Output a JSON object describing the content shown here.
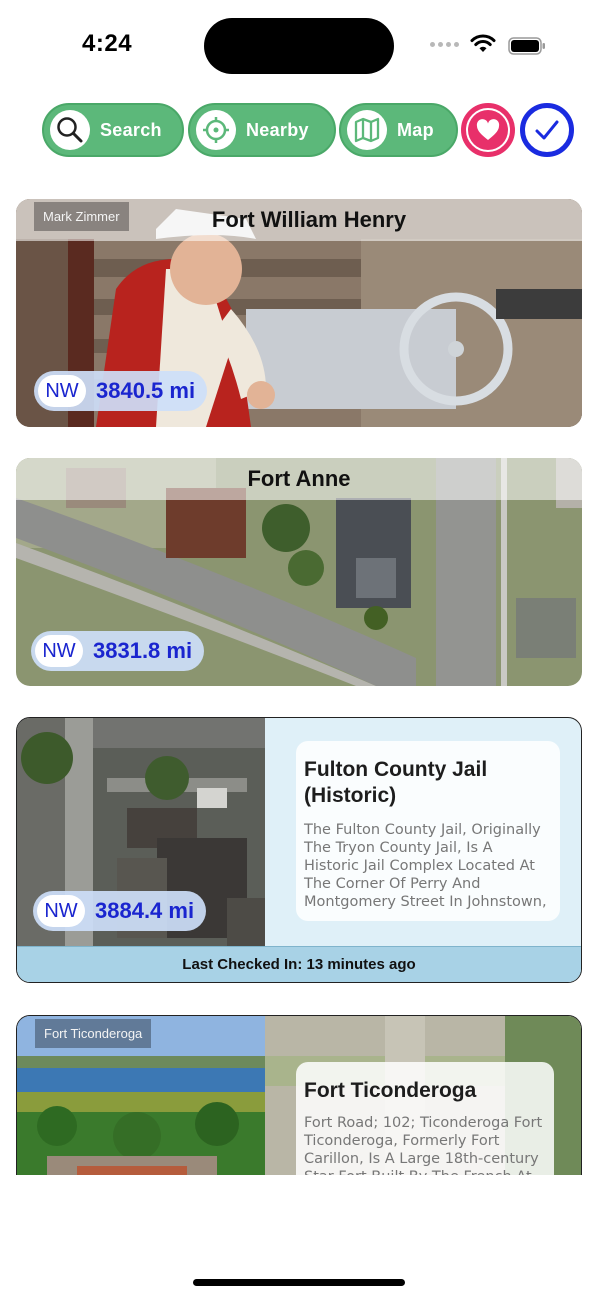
{
  "status": {
    "time": "4:24"
  },
  "toolbar": {
    "search_label": "Search",
    "nearby_label": "Nearby",
    "map_label": "Map",
    "colors": {
      "pill": "#5cb87a",
      "favorites": "#e8306a",
      "visited": "#1a2be0"
    }
  },
  "cards": [
    {
      "title": "Fort William Henry",
      "credit": "Mark Zimmer",
      "direction": "NW",
      "distance": "3840.5 mi"
    },
    {
      "title": "Fort Anne",
      "direction": "NW",
      "distance": "3831.8 mi"
    },
    {
      "title": "Fulton County Jail (Historic)",
      "description": "The Fulton County Jail, Originally The Tryon County Jail, Is A Historic Jail Complex Located At The Corner Of Perry And Montgomery Street In Johnstown,",
      "direction": "NW",
      "distance": "3884.4 mi",
      "last_checked": "Last Checked In: 13 minutes ago"
    },
    {
      "title": "Fort Ticonderoga",
      "credit": "Fort Ticonderoga",
      "description": "Fort Road; 102; Ticonderoga Fort Ticonderoga, Formerly Fort Carillon, Is A Large 18th-century Star Fort Built By The French At"
    }
  ]
}
